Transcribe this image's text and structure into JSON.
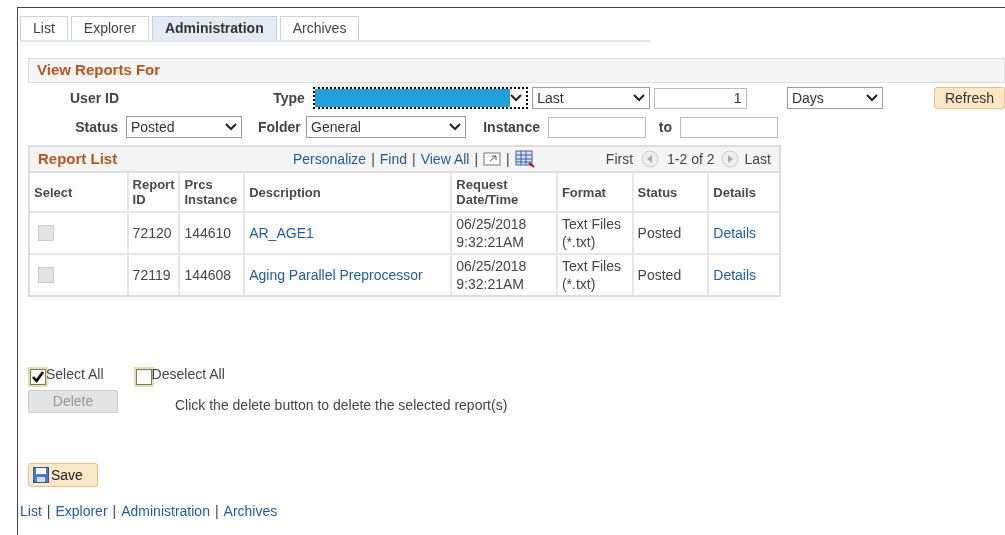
{
  "tabs": [
    {
      "label": "List",
      "selected": false
    },
    {
      "label": "Explorer",
      "selected": false
    },
    {
      "label": "Administration",
      "selected": true
    },
    {
      "label": "Archives",
      "selected": false
    }
  ],
  "filter_panel": {
    "title": "View Reports For",
    "user_id_label": "User ID",
    "type": {
      "label": "Type",
      "focused": true
    },
    "period": {
      "value": "Last"
    },
    "count": {
      "value": "1"
    },
    "unit": {
      "value": "Days"
    },
    "refresh_button": "Refresh",
    "status": {
      "label": "Status",
      "value": "Posted"
    },
    "folder": {
      "label": "Folder",
      "value": "General"
    },
    "instance": {
      "label": "Instance"
    },
    "to": {
      "label": "to"
    }
  },
  "report_list": {
    "title": "Report List",
    "toolbar_links": [
      "Personalize",
      "Find",
      "View All"
    ],
    "separator": "|",
    "pager": {
      "first": "First",
      "range": "1-2 of 2",
      "last": "Last"
    },
    "columns": [
      "Select",
      "Report ID",
      "Prcs Instance",
      "Description",
      "Request Date/Time",
      "Format",
      "Status",
      "Details"
    ],
    "rows": [
      {
        "checked": false,
        "disabled": true,
        "report_id": "72120",
        "prcs_instance": "144610",
        "description": "AR_AGE1",
        "date": "06/25/2018",
        "time": "9:32:21AM",
        "format": "Text Files (*.txt)",
        "status": "Posted",
        "details": "Details"
      },
      {
        "checked": false,
        "disabled": true,
        "report_id": "72119",
        "prcs_instance": "144608",
        "description": "Aging Parallel Preprocessor",
        "date": "06/25/2018",
        "time": "9:32:21AM",
        "format": "Text Files (*.txt)",
        "status": "Posted",
        "details": "Details"
      }
    ]
  },
  "select_all": {
    "label": "Select All",
    "checked": true
  },
  "deselect_all": {
    "label": "Deselect All",
    "checked": false
  },
  "delete_button": {
    "label": "Delete",
    "disabled": true
  },
  "delete_hint": "Click the delete button to delete the selected report(s)",
  "save_button": "Save",
  "footer_links": [
    "List",
    "Explorer",
    "Administration",
    "Archives"
  ],
  "footer_separator": "|"
}
